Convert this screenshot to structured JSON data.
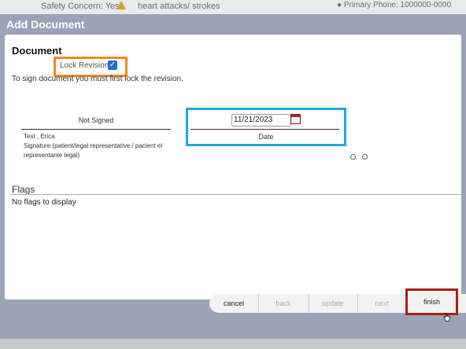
{
  "background_app": {
    "safety_label": "Safety Concern:",
    "safety_value": "Yes",
    "alert_text": "heart attacks/ strokes",
    "phone_text": "Primary Phone: 1000000-0000"
  },
  "dialog": {
    "title": "Add Document",
    "section_title": "Document",
    "lock_revision_label": "Lock Revision",
    "lock_revision_checked": true,
    "sign_hint": "To sign document you must first lock the revision.",
    "signature": {
      "status": "Not Signed",
      "signer_name": "Test , Erica",
      "role": "Signature (patient/legal representative / pacient el representante legal)"
    },
    "date": {
      "value": "11/21/2023",
      "label": "Date"
    },
    "flags": {
      "title": "Flags",
      "empty_text": "No flags to display"
    }
  },
  "buttons": {
    "cancel": "cancel",
    "back": "back",
    "update": "update",
    "next": "next",
    "finish": "finish"
  },
  "colors": {
    "dialog_bg": "#9aa3b8",
    "orange_highlight": "#f18a1d",
    "blue_highlight": "#1da9de",
    "red_highlight": "#b01d10",
    "checkbox": "#1f6fd6"
  },
  "icons": {
    "warning": "warning-icon",
    "phone": "phone-icon",
    "calendar": "calendar-icon",
    "cursor": "hand-cursor-icon"
  }
}
